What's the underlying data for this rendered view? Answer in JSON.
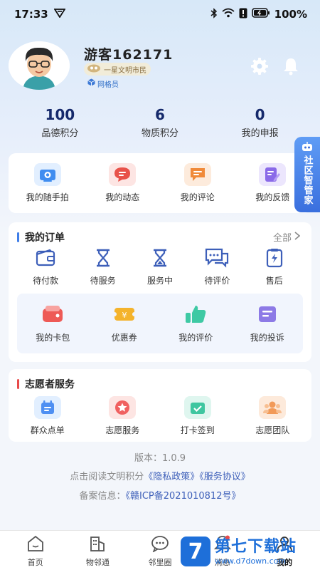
{
  "status_bar": {
    "time": "17:33",
    "battery": "100%"
  },
  "profile": {
    "username": "游客162171",
    "title_badge": "一星文明市民",
    "role_badge": "网格员"
  },
  "stats": [
    {
      "value": "100",
      "label": "品德积分"
    },
    {
      "value": "6",
      "label": "物质积分"
    },
    {
      "value": "0",
      "label": "我的申报"
    }
  ],
  "quick_actions": [
    {
      "label": "我的随手拍",
      "icon": "camera-icon",
      "color": "#3f8df0"
    },
    {
      "label": "我的动态",
      "icon": "message-icon",
      "color": "#e8524a"
    },
    {
      "label": "我的评论",
      "icon": "comment-icon",
      "color": "#f08a3a"
    },
    {
      "label": "我的反馈",
      "icon": "edit-icon",
      "color": "#8a6ae8"
    }
  ],
  "side_tab": {
    "text": "社区智管家"
  },
  "orders": {
    "title": "我的订单",
    "more": "全部",
    "items": [
      {
        "label": "待付款",
        "icon": "wallet-icon"
      },
      {
        "label": "待服务",
        "icon": "hourglass-icon"
      },
      {
        "label": "服务中",
        "icon": "hourglass-icon"
      },
      {
        "label": "待评价",
        "icon": "chat-icon"
      },
      {
        "label": "售后",
        "icon": "service-icon"
      }
    ],
    "sub_items": [
      {
        "label": "我的卡包",
        "icon": "card-wallet-icon",
        "color": "#ee5a56"
      },
      {
        "label": "优惠券",
        "icon": "coupon-icon",
        "color": "#f4b32c"
      },
      {
        "label": "我的评价",
        "icon": "thumbs-up-icon",
        "color": "#3ec9a4"
      },
      {
        "label": "我的投诉",
        "icon": "complaint-icon",
        "color": "#8d7ae6"
      }
    ]
  },
  "volunteer": {
    "title": "志愿者服务",
    "items": [
      {
        "label": "群众点单",
        "icon": "calendar-icon",
        "color": "#4e8ff2"
      },
      {
        "label": "志愿服务",
        "icon": "star-icon",
        "color": "#f06060"
      },
      {
        "label": "打卡签到",
        "icon": "checkin-icon",
        "color": "#3fc6a0"
      },
      {
        "label": "志愿团队",
        "icon": "team-icon",
        "color": "#f29a58"
      }
    ]
  },
  "footer": {
    "version": "版本：1.0.9",
    "read_prefix": "点击阅读文明积分",
    "privacy": "《隐私政策》",
    "service": "《服务协议》",
    "icp_label": "备案信息：",
    "icp": "《赣ICP备2021010812号》"
  },
  "tabbar": [
    {
      "label": "首页",
      "icon": "home-icon"
    },
    {
      "label": "物邻通",
      "icon": "building-icon"
    },
    {
      "label": "邻里圈",
      "icon": "chat-bubble-icon"
    },
    {
      "label": "消息",
      "icon": "bell-icon"
    },
    {
      "label": "我的",
      "icon": "user-icon"
    }
  ],
  "watermark": {
    "logo": "7",
    "title": "第七下载站",
    "url": "www.d7down.com"
  },
  "colors": {
    "accent": "#3d5fb9",
    "stat_number": "#15296b",
    "orders_bar": "#3f7ee8",
    "volunteer_bar": "#e84a4a"
  }
}
